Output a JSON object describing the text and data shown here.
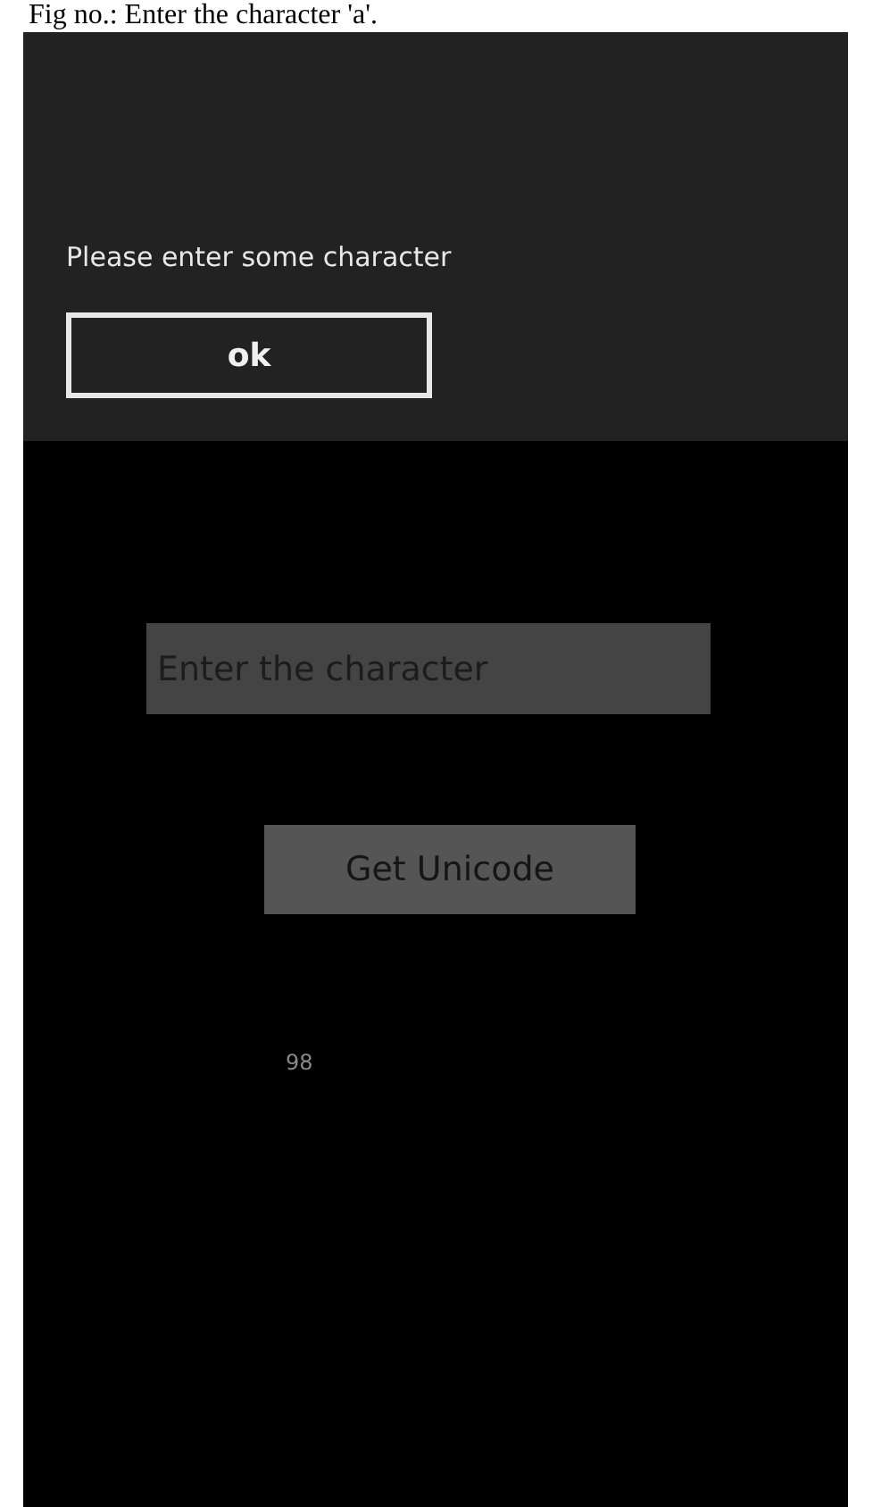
{
  "caption": "Fig no.: Enter the character 'a'.",
  "dialog": {
    "message": "Please enter some character",
    "button": "ok"
  },
  "field": {
    "placeholder": "Enter the character"
  },
  "button": "Get Unicode",
  "result": "98"
}
